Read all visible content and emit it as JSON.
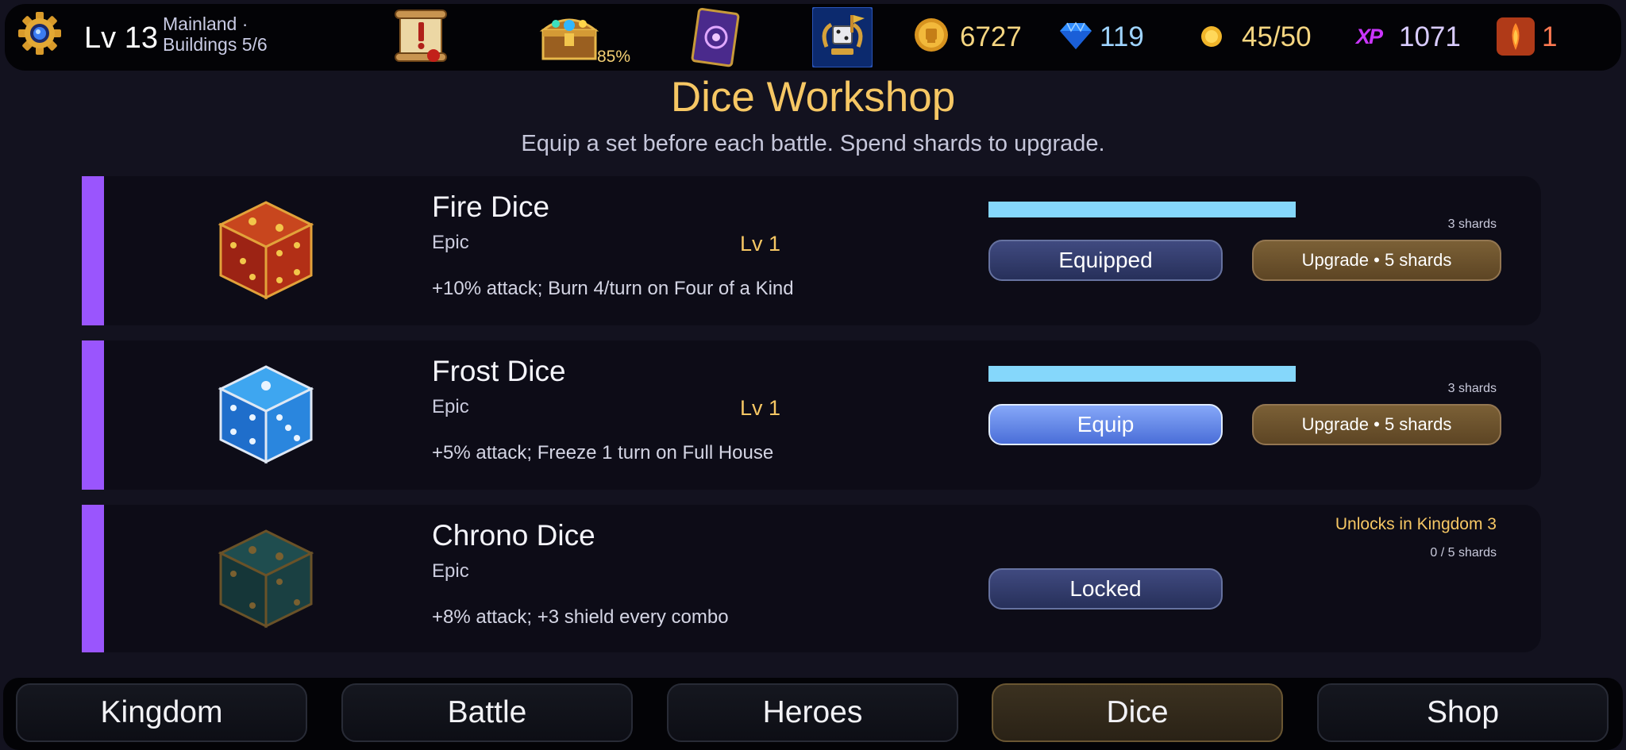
{
  "player": {
    "level": "Lv 13",
    "location": "Mainland  ·",
    "buildings": "Buildings 5/6"
  },
  "resources": {
    "chest_percent": "85%",
    "coins": "6727",
    "gems": "119",
    "energy": "45/50",
    "xp_label": "XP",
    "xp": "1071",
    "flame": "1"
  },
  "page": {
    "title": "Dice Workshop",
    "subtitle": "Equip a set before each battle. Spend shards to upgrade."
  },
  "dice": [
    {
      "name": "Fire Dice",
      "rarity": "Epic",
      "level": "Lv 1",
      "description": "+10% attack; Burn 4/turn on Four of a Kind",
      "shards": "3 shards",
      "shard_progress": 1.0,
      "action": "Equipped",
      "upgrade": "Upgrade • 5 shards",
      "color": "#c0301a"
    },
    {
      "name": "Frost Dice",
      "rarity": "Epic",
      "level": "Lv 1",
      "description": "+5% attack; Freeze 1 turn on Full House",
      "shards": "3 shards",
      "shard_progress": 1.0,
      "action": "Equip",
      "upgrade": "Upgrade • 5 shards",
      "color": "#2a8ee0"
    },
    {
      "name": "Chrono Dice",
      "rarity": "Epic",
      "description": "+8% attack; +3 shield every combo",
      "unlock_note": "Unlocks in Kingdom 3",
      "shards": "0 / 5 shards",
      "shard_progress": 0.0,
      "action": "Locked",
      "color": "#1d4a4a"
    }
  ],
  "nav": {
    "items": [
      "Kingdom",
      "Battle",
      "Heroes",
      "Dice",
      "Shop"
    ],
    "active": "Dice"
  },
  "colors": {
    "accent_gold": "#f6c764",
    "rarity_epic": "#9a55fd",
    "progress": "#85d7fb"
  }
}
